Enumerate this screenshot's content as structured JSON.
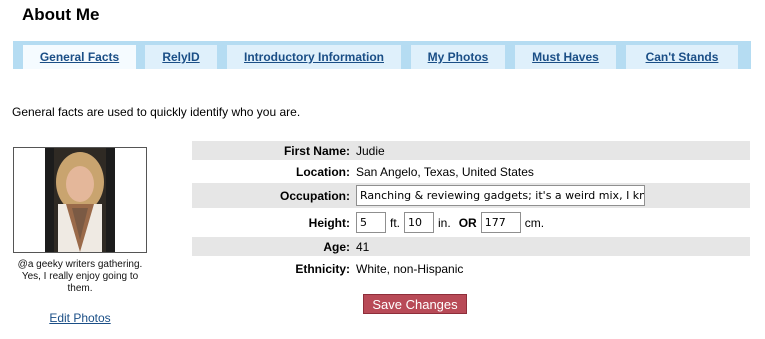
{
  "page": {
    "title": "About Me"
  },
  "tabs": [
    {
      "label": "General Facts",
      "active": true
    },
    {
      "label": "RelyID"
    },
    {
      "label": "Introductory Information"
    },
    {
      "label": "My Photos"
    },
    {
      "label": "Must Haves"
    },
    {
      "label": "Can't Stands"
    }
  ],
  "intro": "General facts are used to quickly identify who you are.",
  "photo": {
    "caption": "@a geeky writers gathering. Yes, I really enjoy going to them.",
    "edit_label": "Edit Photos"
  },
  "form": {
    "first_name": {
      "label": "First Name:",
      "value": "Judie"
    },
    "location": {
      "label": "Location:",
      "value": "San Angelo, Texas, United States"
    },
    "occupation": {
      "label": "Occupation:",
      "value": "Ranching & reviewing gadgets; it's a weird mix, I kno"
    },
    "height": {
      "label": "Height:",
      "feet": "5",
      "feet_unit": "ft.",
      "inches": "10",
      "inches_unit": "in.",
      "or": "OR",
      "cm": "177",
      "cm_unit": "cm."
    },
    "age": {
      "label": "Age:",
      "value": "41"
    },
    "ethnicity": {
      "label": "Ethnicity:",
      "value": "White, non-Hispanic"
    }
  },
  "actions": {
    "save_label": "Save Changes"
  },
  "colors": {
    "tab_bar": "#b5dcf2",
    "tab": "#dff0fb",
    "link": "#1a4e86",
    "row_shade": "#e6e6e6",
    "save_button": "#b84a57"
  }
}
